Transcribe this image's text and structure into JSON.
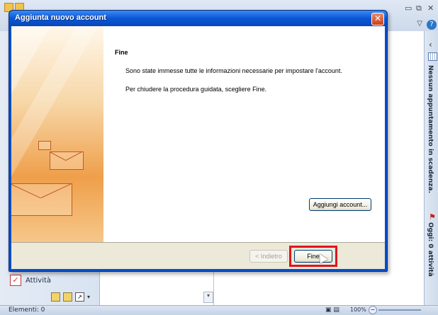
{
  "dialog": {
    "title": "Aggiunta nuovo account",
    "close_label": "✕",
    "heading": "Fine",
    "paragraph1": "Sono state immesse tutte le informazioni necessarie per impostare l'account.",
    "paragraph2": "Per chiudere la procedura guidata, scegliere Fine.",
    "add_account_label": "Aggiungi account...",
    "back_label": "< Indietro",
    "finish_label": "Fine"
  },
  "navigation": {
    "tasks_label": "Attività"
  },
  "todo_bar": {
    "appointments_label": "Nessun appuntamento in scadenza.",
    "tasks_label": "Oggi: 0 attività"
  },
  "status_bar": {
    "items_label": "Elementi: 0",
    "zoom": "100%"
  },
  "colors": {
    "dialog_frame": "#0a4fc8",
    "highlight": "#e0141e",
    "banner": "#ef9f4a"
  }
}
